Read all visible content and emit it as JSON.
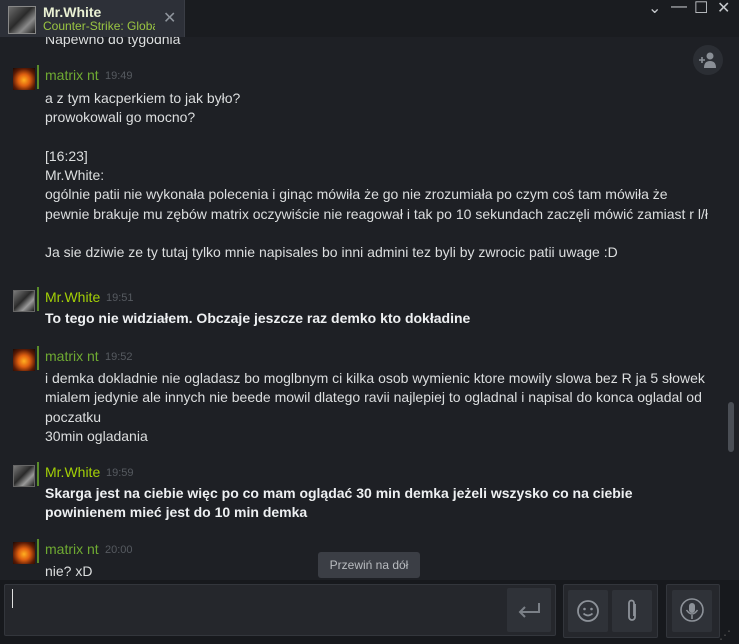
{
  "tab": {
    "name": "Mr.White",
    "status": "Counter-Strike: Global Offensive"
  },
  "window_buttons": {
    "menu": "⌄",
    "minimize": "—",
    "maximize": "☐",
    "close": "✕"
  },
  "chat": {
    "clipped_previous": "Napewno do tygodnia",
    "messages": [
      {
        "author": "matrix nt",
        "time": "19:49",
        "text": "a z tym kacperkiem to jak było?\nprowokowali go mocno?\n\n[16:23]\nMr.White:\nogólnie patii nie wykonała polecenia i ginąc mówiła że go nie zrozumiała po czym coś tam mówiła że pewnie brakuje mu zębów matrix oczywiście nie reagował i tak po 10 sekundach zaczęli mówić zamiast r l/ł\n\nJa sie dziwie ze ty tutaj tylko mnie napisales bo inni admini tez byli by zwrocic patii uwage :D"
      },
      {
        "author": "Mr.White",
        "time": "19:51",
        "text": "To tego nie widziałem. Obczaje jeszcze raz demko kto dokładine"
      },
      {
        "author": "matrix nt",
        "time": "19:52",
        "text": "i demka dokladnie nie ogladasz bo moglbnym ci kilka osob wymienic ktore mowily slowa bez R ja 5 słowek mialem jedynie ale innych nie beede mowil dlatego ravii najlepiej to ogladnal i napisal do konca ogladal od poczatku\n30min ogladania"
      },
      {
        "author": "Mr.White",
        "time": "19:59",
        "text": "Skarga jest na ciebie więc po co mam oglądać 30 min demka jeżeli wszysko co na ciebie powinienem mieć jest do 10 min demka"
      },
      {
        "author": "matrix nt",
        "time": "20:00",
        "text": "nie? xD"
      }
    ]
  },
  "scroll_to_bottom_label": "Przewiń na dół",
  "input": {
    "value": "",
    "placeholder": ""
  },
  "icons": {
    "send": "⮠",
    "emoji": "☺",
    "attach": "📎",
    "voice": "🎙",
    "people": "👤"
  }
}
